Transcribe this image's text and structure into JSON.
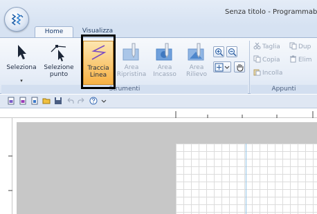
{
  "window": {
    "title": "Senza titolo - Programmab"
  },
  "tabs": [
    {
      "label": "Home",
      "active": true
    },
    {
      "label": "Visualizza",
      "active": false
    }
  ],
  "ribbon": {
    "tools_group_label": "Strumenti",
    "clipboard_group_label": "Appunti",
    "tools": {
      "seleziona": {
        "label": "Seleziona",
        "caret": "▾",
        "icon": "arrow-pointer-icon"
      },
      "selezione_punto": {
        "label_line1": "Selezione",
        "label_line2": "punto",
        "icon": "point-select-icon"
      },
      "traccia_linea": {
        "label_line1": "Traccia",
        "label_line2": "Linea",
        "icon": "trace-line-icon",
        "state": "selected"
      },
      "area_ripristina": {
        "label_line1": "Area",
        "label_line2": "Ripristina",
        "icon": "area-restore-icon",
        "state": "disabled"
      },
      "area_incasso": {
        "label_line1": "Area",
        "label_line2": "Incasso",
        "icon": "area-emboss-icon",
        "state": "disabled"
      },
      "area_rilievo": {
        "label_line1": "Area",
        "label_line2": "Rilievo",
        "icon": "area-relief-icon",
        "state": "disabled"
      }
    },
    "view_buttons": [
      "zoom-in-icon",
      "zoom-out-icon",
      "fit-view-icon",
      "pan-hand-icon"
    ],
    "clipboard": {
      "taglia": "Taglia",
      "copia": "Copia",
      "incolla": "Incolla",
      "duplica": "Dup",
      "elimina": "Elim"
    }
  },
  "qat": [
    "new-file-icon",
    "open-file-icon",
    "import-icon",
    "open-folder-icon",
    "save-icon",
    "undo-icon",
    "redo-icon",
    "help-icon",
    "customize-caret-icon"
  ],
  "colors": {
    "selected_tool": "#f7b144",
    "selection_frame": "#000000",
    "canvas_background": "#c7c7c7",
    "grid_line": "#dcdcdc",
    "center_line": "#8fc3e8"
  }
}
